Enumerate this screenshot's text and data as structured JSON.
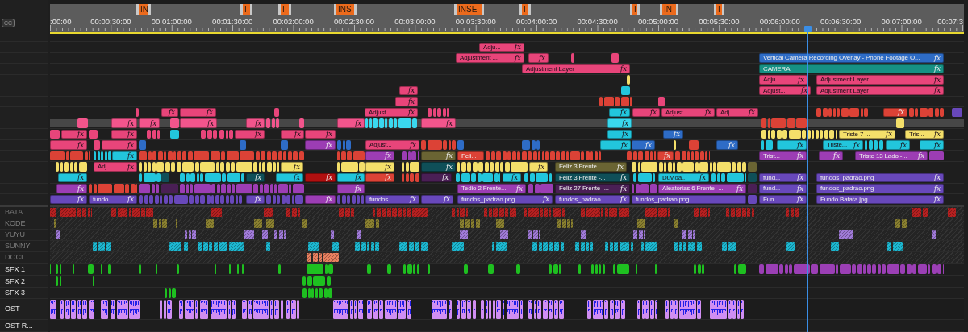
{
  "cc_button": "CC",
  "ruler": {
    "timecodes": [
      ":00:00",
      "00:00:30:00",
      "00:01:00:00",
      "00:01:30:00",
      "00:02:00:00",
      "00:02:30:00",
      "00:03:00:00",
      "00:03:30:00",
      "00:04:00:00",
      "00:04:30:00",
      "00:05:00:00",
      "00:05:30:00",
      "00:06:00:00",
      "00:06:30:00",
      "00:07:00:00",
      "00:07:3"
    ],
    "markers": [
      "IN",
      "I",
      "I",
      "INS",
      "INSE",
      "I",
      "I",
      "IN",
      "I"
    ]
  },
  "video_tracks": [
    {
      "kind": "plain",
      "clips": [
        {
          "label": "Adju...",
          "fx": "fx",
          "color": "#e8457a"
        }
      ]
    },
    {
      "kind": "plain",
      "palette": [
        {
          "color": "#e8457a"
        }
      ],
      "clips": [
        {
          "label": "Adjustment ...",
          "fx": "fx",
          "color": "#e8457a"
        },
        {
          "fx": "fx",
          "color": "#e8457a"
        },
        {
          "label": "Vertical Camera Recording Overlay - Phone Footage O...",
          "fx": "fx",
          "color": "#2e6cc6"
        }
      ]
    },
    {
      "kind": "plain",
      "clips": [
        {
          "label": "Adjustment Layer",
          "fx": "fx",
          "color": "#e8457a"
        },
        {
          "label": "CAMERA",
          "fx": "fx",
          "color": "#169184"
        }
      ]
    },
    {
      "kind": "plain",
      "palette": [
        {
          "color": "#f4df6a"
        }
      ],
      "clips": [
        {
          "label": "Adju...",
          "fx": "fx",
          "color": "#e8457a"
        },
        {
          "label": "Adjustment Layer",
          "fx": "fx",
          "color": "#e8457a"
        }
      ]
    },
    {
      "kind": "plain",
      "palette": [
        {
          "color": "#22c6dc"
        }
      ],
      "clips": [
        {
          "fx": "fx",
          "color": "#e8457a"
        },
        {
          "label": "Adjust...",
          "fx": "fx",
          "color": "#e8457a"
        },
        {
          "label": "Adjustment Layer",
          "fx": "fx",
          "color": "#e8457a"
        }
      ]
    },
    {
      "kind": "plain",
      "palette": [
        {
          "color": "#dc4236"
        },
        {
          "color": "#e8457a"
        }
      ],
      "clips": [
        {
          "fx": "fx",
          "color": "#e8457a"
        }
      ]
    },
    {
      "kind": "plain",
      "palette": [
        {
          "color": "#e8457a"
        },
        {
          "color": "#dc4236"
        },
        {
          "color": "#6848bb"
        }
      ],
      "clips": [
        {
          "fx": "fx",
          "color": "#e8457a"
        },
        {
          "fx": "fx",
          "color": "#e8457a"
        },
        {
          "label": "Adjust...",
          "fx": "fx",
          "color": "#e8457a"
        },
        {
          "fx": "fx",
          "color": "#22c6dc"
        },
        {
          "fx": "fx",
          "color": "#e8457a"
        },
        {
          "label": "Adjust...",
          "fx": "fx",
          "color": "#e8457a"
        },
        {
          "label": "Adj...",
          "fx": "fx",
          "color": "#e8457a"
        },
        {
          "fx": "fx",
          "color": "#dc4236"
        }
      ]
    },
    {
      "kind": "bar",
      "palette": [
        {
          "color": "#f2558c"
        },
        {
          "color": "#3ad8ee"
        },
        {
          "color": "#dc4236"
        },
        {
          "color": "#f4df6a"
        }
      ],
      "clips": [
        {
          "fx": "fx",
          "color": "#f2558c"
        },
        {
          "fx": "fx",
          "color": "#f2558c"
        },
        {
          "fx": "fx",
          "color": "#f2558c"
        },
        {
          "fx": "fx",
          "color": "#f2558c"
        },
        {
          "fx": "fx",
          "color": "#f2558c"
        },
        {
          "fx": "fx",
          "color": "#f2558c"
        },
        {
          "fx": "fx",
          "color": "#3ad8ee"
        }
      ]
    },
    {
      "kind": "plain",
      "palette": [
        {
          "color": "#e8457a"
        },
        {
          "color": "#22c6dc"
        },
        {
          "color": "#f4df6a"
        }
      ],
      "clips": [
        {
          "fx": "fx",
          "color": "#e8457a"
        },
        {
          "fx": "fx",
          "color": "#e8457a"
        },
        {
          "fx": "fx",
          "color": "#e8457a"
        },
        {
          "fx": "fx",
          "color": "#e8457a"
        },
        {
          "fx": "fx",
          "color": "#e8457a"
        },
        {
          "fx": "fx",
          "color": "#22c6dc"
        },
        {
          "fx": "fx",
          "color": "#2e6cc6"
        },
        {
          "label": "Triste 7 ...",
          "fx": "fx",
          "color": "#f4df6a"
        },
        {
          "label": "Tris...",
          "fx": "fx",
          "color": "#f4df6a"
        }
      ]
    },
    {
      "kind": "plain",
      "palette": [
        {
          "color": "#e8457a"
        },
        {
          "color": "#2e6cc6"
        },
        {
          "color": "#dc4236"
        },
        {
          "color": "#22c6dc"
        },
        {
          "color": "#f4df6a"
        }
      ],
      "clips": [
        {
          "fx": "fx",
          "color": "#e8457a"
        },
        {
          "fx": "fx",
          "color": "#e8457a"
        },
        {
          "fx": "fx",
          "color": "#9c3db4"
        },
        {
          "label": "Adjust...",
          "fx": "fx",
          "color": "#e8457a"
        },
        {
          "fx": "fx",
          "color": "#22c6dc"
        },
        {
          "fx": "fx",
          "color": "#2e6cc6"
        },
        {
          "fx": "fx",
          "color": "#2e6cc6"
        },
        {
          "fx": "fx",
          "color": "#22c6dc"
        },
        {
          "label": "Triste...",
          "fx": "fx",
          "color": "#22c6dc"
        },
        {
          "fx": "fx",
          "color": "#22c6dc"
        },
        {
          "fx": "fx",
          "color": "#22c6dc"
        }
      ]
    },
    {
      "kind": "plain",
      "palette": [
        {
          "color": "#dc4236"
        },
        {
          "color": "#22c6dc"
        },
        {
          "color": "#9c3db4"
        }
      ],
      "clips": [
        {
          "fx": "fx",
          "color": "#22c6dc"
        },
        {
          "fx": "fx",
          "color": "#9c3db4"
        },
        {
          "fx": "fx",
          "color": "#6a6433"
        },
        {
          "label": "Feli...",
          "color": "#dc4236"
        },
        {
          "fx": "fx",
          "color": "#dc4236"
        },
        {
          "label": "Trist...",
          "fx": "fx",
          "color": "#9c3db4"
        },
        {
          "fx": "fx",
          "color": "#9c3db4"
        },
        {
          "label": "Triste 13 Lado -...",
          "fx": "fx",
          "color": "#9c3db4"
        }
      ]
    },
    {
      "kind": "plain",
      "palette": [
        {
          "color": "#f4df6a"
        },
        {
          "color": "#6a6433"
        }
      ],
      "clips": [
        {
          "label": "Adj...",
          "fx": "fx",
          "color": "#e8457a"
        },
        {
          "fx": "fx",
          "color": "#f4df6a"
        },
        {
          "fx": "fx",
          "color": "#f4df6a"
        },
        {
          "fx": "fx",
          "color": "#0f4f58"
        },
        {
          "fx": "fx",
          "color": "#f4df6a"
        },
        {
          "label": "Feliz 3 Frente ...",
          "fx": "fx",
          "color": "#6a6433"
        }
      ]
    },
    {
      "kind": "plain",
      "palette": [
        {
          "color": "#22c6dc"
        },
        {
          "color": "#0f4f58"
        },
        {
          "color": "#dc4236"
        }
      ],
      "clips": [
        {
          "fx": "fx",
          "color": "#22c6dc"
        },
        {
          "fx": "fx",
          "color": "#0f4f58"
        },
        {
          "fx": "fx",
          "color": "#22c6dc"
        },
        {
          "fx": "fx",
          "color": "#b01010"
        },
        {
          "fx": "fx",
          "color": "#22c6dc"
        },
        {
          "fx": "fx",
          "color": "#dc4236"
        },
        {
          "fx": "fx",
          "color": "#4a1f55"
        },
        {
          "fx": "fx",
          "color": "#22c6dc"
        },
        {
          "label": "Feliz 3 Frente -...",
          "fx": "fx",
          "color": "#0f4f58"
        },
        {
          "label": "Duvida...",
          "fx": "fx",
          "color": "#22c6dc"
        },
        {
          "label": "fund...",
          "fx": "fx",
          "color": "#6848bb"
        },
        {
          "label": "fundos_padrao.png",
          "fx": "fx",
          "color": "#6848bb"
        }
      ]
    },
    {
      "kind": "plain",
      "palette": [
        {
          "color": "#9c3db4"
        },
        {
          "color": "#dc4236"
        },
        {
          "color": "#4a1f55"
        }
      ],
      "clips": [
        {
          "fx": "fx",
          "color": "#9c3db4"
        },
        {
          "fx": "fx",
          "color": "#9c3db4"
        },
        {
          "label": "Tedio 2 Frente...",
          "fx": "fx",
          "color": "#9c3db4"
        },
        {
          "label": "Feliz 27 Frente -...",
          "fx": "fx",
          "color": "#4a1f55"
        },
        {
          "label": "Aleatorias 6 Frente -...",
          "fx": "fx",
          "color": "#9c3db4"
        },
        {
          "label": "fund...",
          "fx": "fx",
          "color": "#6848bb"
        },
        {
          "label": "fundos_padrao.png",
          "fx": "fx",
          "color": "#6848bb"
        }
      ]
    },
    {
      "kind": "plain",
      "palette": [
        {
          "color": "#6848bb"
        }
      ],
      "clips": [
        {
          "fx": "fx",
          "color": "#6848bb"
        },
        {
          "label": "fundo...",
          "fx": "fx",
          "color": "#6848bb"
        },
        {
          "fx": "fx",
          "color": "#6848bb"
        },
        {
          "fx": "fx",
          "color": "#9c3db4"
        },
        {
          "label": "fundos...",
          "fx": "fx",
          "color": "#6848bb"
        },
        {
          "fx": "fx",
          "color": "#6848bb"
        },
        {
          "label": "fundos_padrao.png",
          "fx": "fx",
          "color": "#6848bb"
        },
        {
          "label": "fundos_padrao...",
          "fx": "fx",
          "color": "#6848bb"
        },
        {
          "label": "fundos_padrao.png",
          "color": "#6848bb"
        },
        {
          "label": "Fun...",
          "fx": "fx",
          "color": "#6848bb"
        },
        {
          "label": "Fundo Batata.jpg",
          "fx": "fx",
          "color": "#6848bb"
        }
      ]
    }
  ],
  "audio_tracks": [
    {
      "name": "BATA...",
      "kind": "lane",
      "disabled": true,
      "palette": [
        {
          "color": "#b52020"
        }
      ]
    },
    {
      "name": "KODE",
      "kind": "lane",
      "disabled": true,
      "palette": [
        {
          "color": "#8a8030"
        }
      ]
    },
    {
      "name": "YUYU",
      "kind": "lane",
      "disabled": true,
      "palette": [
        {
          "color": "#a07ad8"
        }
      ]
    },
    {
      "name": "SUNNY",
      "kind": "lane",
      "disabled": true,
      "palette": [
        {
          "color": "#1db7d0"
        }
      ]
    },
    {
      "name": "DOCI",
      "kind": "lane",
      "disabled": true,
      "palette": [
        {
          "color": "#e88060"
        }
      ]
    },
    {
      "name": "SFX 1",
      "kind": "sfx",
      "disabled": false,
      "palette": [
        {
          "color": "#1ec020"
        },
        {
          "color": "#9b3fb5"
        }
      ]
    },
    {
      "name": "SFX 2",
      "kind": "sfx",
      "disabled": false,
      "palette": [
        {
          "color": "#1ec020"
        }
      ]
    },
    {
      "name": "SFX 3",
      "kind": "sfx",
      "disabled": false,
      "palette": [
        {
          "color": "#1ec020"
        }
      ]
    },
    {
      "name": "OST",
      "kind": "music",
      "disabled": false,
      "palette": [
        {
          "color": "#d08ef2"
        },
        {
          "color": "#2020e8"
        }
      ]
    },
    {
      "name": "OST R...",
      "kind": "sfx",
      "disabled": false
    }
  ]
}
